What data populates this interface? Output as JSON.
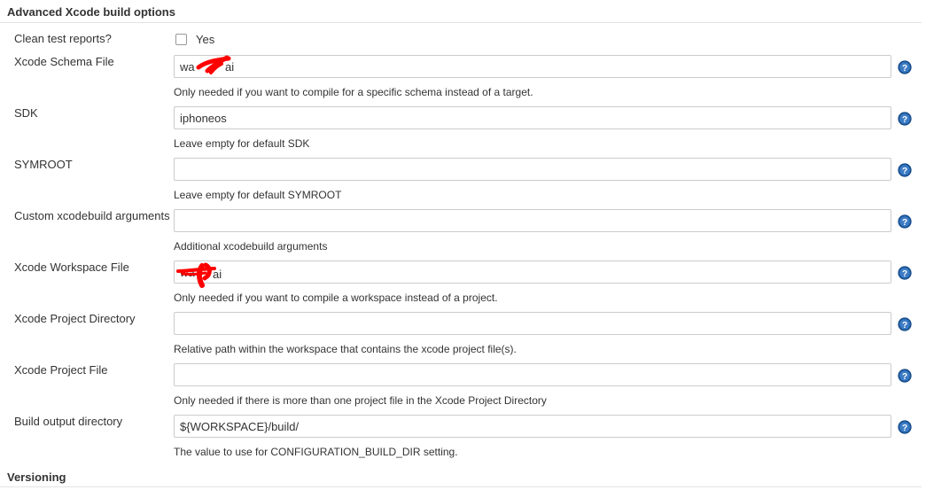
{
  "section": {
    "title": "Advanced Xcode build options"
  },
  "clean_test_reports": {
    "label": "Clean test reports?",
    "checkbox_label": "Yes",
    "checked": false
  },
  "fields": [
    {
      "label": "Xcode Schema File",
      "value": "wa",
      "value_tail": "ai",
      "redacted": true,
      "description": "Only needed if you want to compile for a specific schema instead of a target."
    },
    {
      "label": "SDK",
      "value": "iphoneos",
      "description": "Leave empty for default SDK"
    },
    {
      "label": "SYMROOT",
      "value": "",
      "description": "Leave empty for default SYMROOT"
    },
    {
      "label": "Custom xcodebuild arguments",
      "value": "",
      "description": "Additional xcodebuild arguments"
    },
    {
      "label": "Xcode Workspace File",
      "value": "wa",
      "value_tail": "ai",
      "redacted": true,
      "description": "Only needed if you want to compile a workspace instead of a project."
    },
    {
      "label": "Xcode Project Directory",
      "value": "",
      "description": "Relative path within the workspace that contains the xcode project file(s)."
    },
    {
      "label": "Xcode Project File",
      "value": "",
      "description": "Only needed if there is more than one project file in the Xcode Project Directory"
    },
    {
      "label": "Build output directory",
      "value": "${WORKSPACE}/build/",
      "description": "The value to use for CONFIGURATION_BUILD_DIR setting."
    }
  ],
  "next_section": {
    "title": "Versioning"
  },
  "icons": {
    "help": "help-icon"
  },
  "colors": {
    "help_blue": "#1e5fa6",
    "redaction": "#ff0000",
    "rule": "#e4e4e4"
  }
}
